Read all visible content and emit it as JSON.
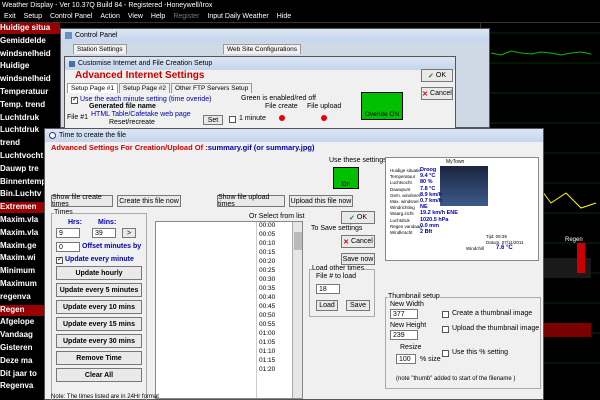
{
  "app": {
    "title": "Weather Display - Ver 10.37Q Build 84 - Registered  -Honeywell/Irox"
  },
  "menu": [
    "Exit",
    "Setup",
    "Control Panel",
    "Action",
    "View",
    "Help",
    "Register",
    "Input Daily Weather",
    "Hide"
  ],
  "sidebar_labels": [
    {
      "text": "Huidige situa",
      "style": "red"
    },
    {
      "text": "Gemiddelde",
      "style": "plain"
    },
    {
      "text": "windsnelheid",
      "style": "plain"
    },
    {
      "text": "Huidige",
      "style": "plain"
    },
    {
      "text": "windsnelheid",
      "style": "plain"
    },
    {
      "text": "Temperatuur",
      "style": "plain"
    },
    {
      "text": "Temp. trend",
      "style": "plain"
    },
    {
      "text": "Luchtdruk",
      "style": "plain"
    },
    {
      "text": "Luchtdruk",
      "style": "plain"
    },
    {
      "text": "trend",
      "style": "plain"
    },
    {
      "text": "Luchtvocht",
      "style": "plain"
    },
    {
      "text": "Dauwp tre",
      "style": "plain"
    },
    {
      "text": "Binnentemp",
      "style": "plain"
    },
    {
      "text": "Bin.Luchtv",
      "style": "plain"
    },
    {
      "text": "Extremen",
      "style": "red"
    },
    {
      "text": "Maxim.vla",
      "style": "plain"
    },
    {
      "text": "Maxim.vla",
      "style": "plain"
    },
    {
      "text": "Maxim.ge",
      "style": "plain"
    },
    {
      "text": "Maxim.wi",
      "style": "plain"
    },
    {
      "text": "Minimum",
      "style": "plain"
    },
    {
      "text": "Maximum",
      "style": "plain"
    },
    {
      "text": "regenva",
      "style": "plain"
    },
    {
      "text": "Regen",
      "style": "red"
    },
    {
      "text": "Afgelope",
      "style": "plain"
    },
    {
      "text": "Vandaag",
      "style": "plain"
    },
    {
      "text": "Gisteren",
      "style": "plain"
    },
    {
      "text": "Deze ma",
      "style": "plain"
    },
    {
      "text": "Dit jaar to",
      "style": "plain"
    },
    {
      "text": "Regenva",
      "style": "plain"
    }
  ],
  "right_panel": {
    "regen_label": "Regen"
  },
  "control_panel": {
    "title": "Control Panel",
    "tab_station": "Station Settings",
    "tab_web": "Web Site Configurations"
  },
  "customise": {
    "title": "Customise Internet and File Creation Setup",
    "heading": "Advanced Internet Settings",
    "tabs": [
      "Setup Page #1",
      "Setup Page #2",
      "Other FTP Servers Setup"
    ],
    "ok": "OK",
    "cancel": "Cancel",
    "use_each_minute": "Use the each minute setting (time overide)",
    "generated_file_name": "Generated file name",
    "green_enabled": "Green is enabled/red off",
    "file_creation": "File create",
    "file_upload": "File upload",
    "file1": "File #1",
    "file1_name": "HTML Table/Cafetake web page",
    "reset_recreate": "Reset/recreate",
    "set": "Set",
    "one_minute": "1 minute",
    "override": "Overide ON"
  },
  "time_dialog": {
    "title": "Time to create the file",
    "heading_a": "Advanced Settings For Creation/Upload Of :",
    "heading_b": "summary.gif (or summary.jpg)",
    "use_these": "Use these settings",
    "on_label": "On",
    "show_create_times": "Show file create times",
    "create_now": "Create this file now",
    "show_upload_times": "Show file upload times",
    "upload_now": "Upload this file now",
    "times_label": "Times",
    "hrs": "Hrs:",
    "mins": "Mins:",
    "hrs_val": "9",
    "mins_val": "39",
    "offset_val": "0",
    "offset_label": "Offset minutes by",
    "update_every_minute": "Update every minute",
    "buttons": [
      "Update hourly",
      "Update every 5 minutes",
      "Update every 10 mins",
      "Update every 15 mins",
      "Update every 30 mins",
      "Remove Time",
      "Clear All"
    ],
    "select_from_list": "Or Select from list",
    "list_times": [
      "00:00",
      "00:05",
      "00:10",
      "00:15",
      "00:20",
      "00:25",
      "00:30",
      "00:35",
      "00:40",
      "00:45",
      "00:50",
      "00:55",
      "01:00",
      "01:05",
      "01:10",
      "01:15",
      "01:20"
    ],
    "ok": "OK",
    "to_save": "To Save settings",
    "cancel": "Cancel",
    "save_now": "Save now",
    "load_other": "Load other times",
    "file_to_load": "File # to load",
    "file_to_load_val": "18",
    "load": "Load",
    "save": "Save",
    "thumbnail_setup": "Thumbnail setup",
    "new_width": "New Width",
    "new_width_val": "377",
    "new_height": "New Height",
    "new_height_val": "239",
    "create_thumb": "Create a thumbnail image",
    "upload_thumb": "Upload the thumbnail image",
    "resize": "Resize",
    "resize_val": "100",
    "pct_size": "% size",
    "use_pct": "Use this % setting",
    "thumb_note": "(note \"thumb\" added to start of the filename )",
    "footer_note": "Note: The times listed are in 24Hr format"
  },
  "preview": {
    "title": "MyTown",
    "rows": [
      {
        "k": "Huidige situatie",
        "v": "Droog"
      },
      {
        "k": "Temperatuur",
        "v": "9.4 °C"
      },
      {
        "k": "Luchtvocht",
        "v": "80 %"
      },
      {
        "k": "Dauwpunt",
        "v": "7.8 °C"
      },
      {
        "k": "Gem. windsnel.",
        "v": "8.9 km/h"
      },
      {
        "k": "Max. windsnel.",
        "v": "0.7 km/h"
      },
      {
        "k": "Windrichting",
        "v": "NE"
      },
      {
        "k": "Waarg.zicht",
        "v": "19.2 km/h ENE"
      },
      {
        "k": "Luchtdruk",
        "v": "1020.5 hPa"
      },
      {
        "k": "Regen vandaag",
        "v": "0.0 mm"
      },
      {
        "k": "Windkracht",
        "v": "2 Bft"
      }
    ],
    "time": "Tijd: 09:39",
    "date": "Datum: 07/11/2011",
    "windchill_label": "Windchill",
    "windchill_val": "7.6 °C"
  },
  "colors": {
    "highlight_green": "#00c000",
    "chart_red": "#c00000",
    "heading_red": "#cc0000"
  }
}
